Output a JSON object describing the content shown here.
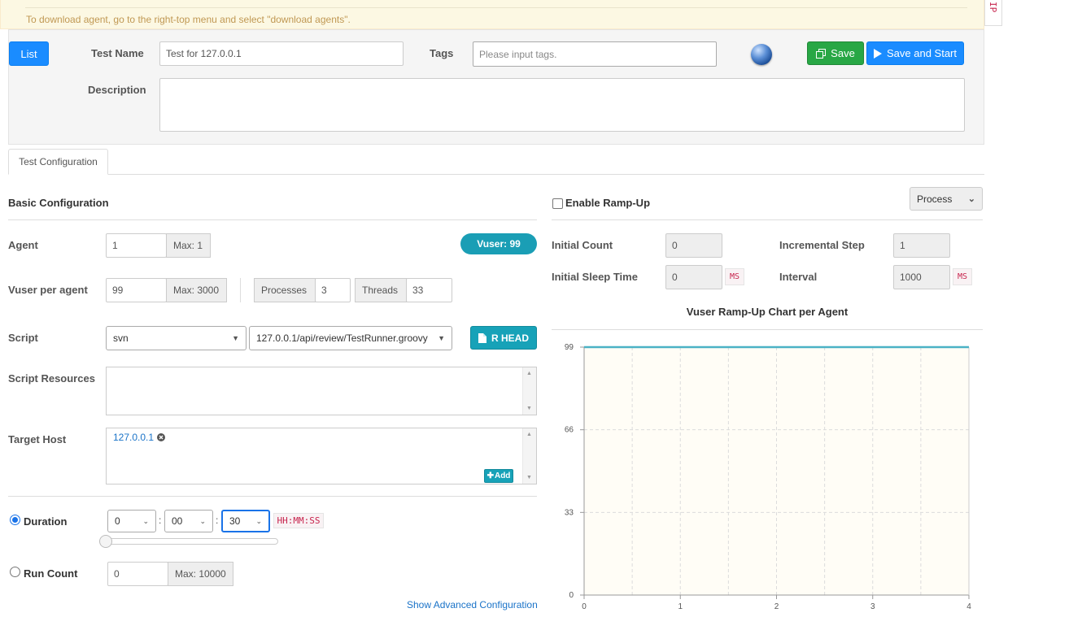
{
  "notice": {
    "text": "To download agent, go to the right-top menu and select \"download agents\"."
  },
  "ip_tab": "IP",
  "top": {
    "list_label": "List",
    "test_name_label": "Test Name",
    "test_name_value": "Test for 127.0.0.1",
    "tags_label": "Tags",
    "tags_placeholder": "Please input tags.",
    "save_label": "Save",
    "save_start_label": "Save and Start",
    "description_label": "Description"
  },
  "tabs": [
    {
      "label": "Test Configuration"
    }
  ],
  "basic": {
    "title": "Basic Configuration",
    "agent_label": "Agent",
    "agent_value": "1",
    "agent_max": "Max: 1",
    "vuser_badge": "Vuser: 99",
    "vuser_label": "Vuser per agent",
    "vuser_value": "99",
    "vuser_max": "Max: 3000",
    "processes_label": "Processes",
    "processes_value": "3",
    "threads_label": "Threads",
    "threads_value": "33",
    "script_label": "Script",
    "script_repo": "svn",
    "script_path": "127.0.0.1/api/review/TestRunner.groovy",
    "rhead_label": "R HEAD",
    "resources_label": "Script Resources",
    "target_label": "Target Host",
    "target_host": "127.0.0.1",
    "add_label": "Add",
    "duration_label": "Duration",
    "duration_hh": "0",
    "duration_mm": "00",
    "duration_ss": "30",
    "duration_format": "HH:MM:SS",
    "duration_slider_fraction": 0,
    "runcount_label": "Run Count",
    "runcount_value": "0",
    "runcount_max": "Max: 10000",
    "advanced_link": "Show Advanced Configuration"
  },
  "rampup": {
    "enable_label": "Enable Ramp-Up",
    "enabled": false,
    "mode": "Process",
    "initial_count_label": "Initial Count",
    "initial_count": "0",
    "incremental_step_label": "Incremental Step",
    "incremental_step": "1",
    "initial_sleep_label": "Initial Sleep Time",
    "initial_sleep": "0",
    "interval_label": "Interval",
    "interval": "1000",
    "unit": "MS"
  },
  "chart_data": {
    "type": "line",
    "title": "Vuser Ramp-Up Chart per Agent",
    "x": [
      0,
      4
    ],
    "series": [
      {
        "values": [
          99,
          99
        ],
        "color": "#4bb2c5"
      }
    ],
    "xlim": [
      0,
      4
    ],
    "ylim": [
      0,
      99
    ],
    "x_ticks": [
      "0",
      "1",
      "2",
      "3",
      "4"
    ],
    "y_ticks": [
      "0",
      "33",
      "66",
      "99"
    ],
    "grid": true,
    "plot_background": "#fffdf6"
  },
  "colors": {
    "primary": "#1a8cff",
    "success": "#28a745",
    "info": "#17a2b8"
  }
}
